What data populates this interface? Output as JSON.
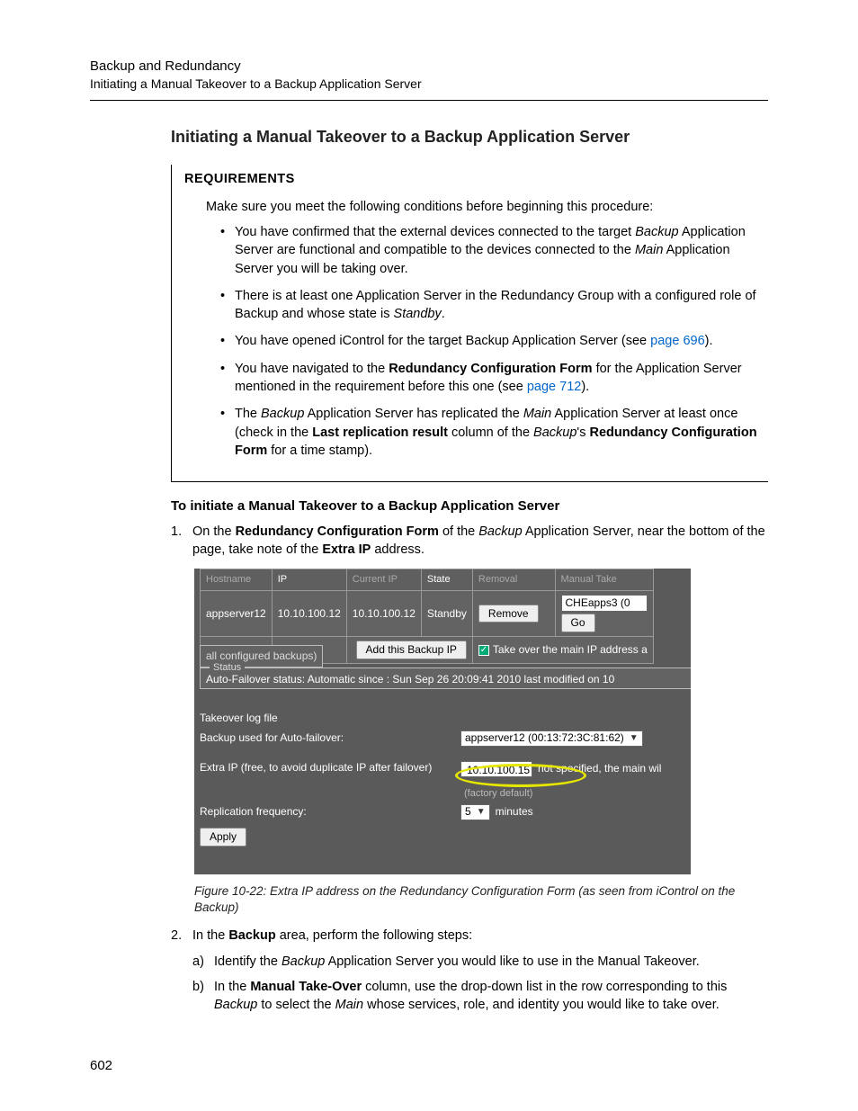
{
  "header": {
    "line1": "Backup and Redundancy",
    "line2": "Initiating a Manual Takeover to a Backup Application Server"
  },
  "section_title": "Initiating a Manual Takeover to a Backup Application Server",
  "requirements": {
    "heading": "REQUIREMENTS",
    "intro": "Make sure you meet the following conditions before beginning this procedure:",
    "items": {
      "r1a": "You have confirmed that the external devices connected to the target ",
      "r1b": "Backup",
      "r1c": " Application Server are functional and compatible to the devices connected to the ",
      "r1d": "Main",
      "r1e": " Application Server you will be taking over.",
      "r2a": "There is at least one Application Server in the Redundancy Group with a configured role of Backup and whose state is ",
      "r2b": "Standby",
      "r2c": ".",
      "r3a": "You have opened iControl for the target Backup Application Server (see ",
      "r3b": "page 696",
      "r3c": ").",
      "r4a": "You have navigated to the ",
      "r4b": "Redundancy Configuration Form",
      "r4c": " for the Application Server mentioned in the requirement before this one (see ",
      "r4d": "page 712",
      "r4e": ").",
      "r5a": "The ",
      "r5b": "Backup",
      "r5c": " Application Server has replicated the ",
      "r5d": "Main",
      "r5e": " Application Server at least once (check in the ",
      "r5f": "Last replication result",
      "r5g": " column of the ",
      "r5h": "Backup",
      "r5i": "'s ",
      "r5j": "Redundancy Configuration Form",
      "r5k": " for a time stamp)."
    }
  },
  "subhead": "To initiate a Manual Takeover to a Backup Application Server",
  "step1": {
    "num": "1.",
    "a": "On the ",
    "b": "Redundancy Configuration Form",
    "c": " of the ",
    "d": "Backup",
    "e": " Application Server, near the bottom of the page, take note of the ",
    "f": "Extra IP",
    "g": " address."
  },
  "figure_caption": "Figure 10-22: Extra IP address on the Redundancy Configuration Form (as seen from iControl on the Backup)",
  "step2": {
    "num": "2.",
    "a": "In the ",
    "b": "Backup",
    "c": " area, perform the following steps:",
    "sa_letter": "a)",
    "sa1": "Identify the ",
    "sa2": "Backup",
    "sa3": " Application Server you would like to use in the Manual Takeover.",
    "sb_letter": "b)",
    "sb1": "In the ",
    "sb2": "Manual Take-Over",
    "sb3": " column, use the drop-down list in the row corresponding to this ",
    "sb4": "Backup",
    "sb5": " to select the ",
    "sb6": "Main",
    "sb7": " whose services, role, and identity you would like to take over."
  },
  "page_num": "602",
  "screenshot": {
    "headers": {
      "hostname": "Hostname",
      "ip": "IP",
      "currentip": "Current IP",
      "state": "State",
      "removal": "Removal",
      "manual": "Manual Take"
    },
    "row": {
      "hostname": "appserver12",
      "ip": "10.10.100.12",
      "currentip": "10.10.100.12",
      "state": "Standby",
      "remove": "Remove",
      "sel": "CHEapps3 (0",
      "go": "Go"
    },
    "add_backup": "Add this Backup IP",
    "takeover_main": "Take over the main IP address a",
    "all_backups": "all configured backups)",
    "status_legend": "Status",
    "status_text": "Auto-Failover status: Automatic since : Sun Sep 26 20:09:41 2010 last modified on 10",
    "rows": {
      "loglabel": "Takeover log file",
      "backup_used_label": "Backup used for Auto-failover:",
      "backup_used_value": "appserver12 (00:13:72:3C:81:62)",
      "extra_ip_label": "Extra IP (free, to avoid duplicate IP after failover)",
      "extra_ip_value": "10.10.100.15",
      "extra_ip_after": "not specified, the main wil",
      "factory": "(factory default)",
      "repl_label": "Replication frequency:",
      "repl_value": "5",
      "repl_unit": "minutes"
    },
    "apply": "Apply"
  }
}
